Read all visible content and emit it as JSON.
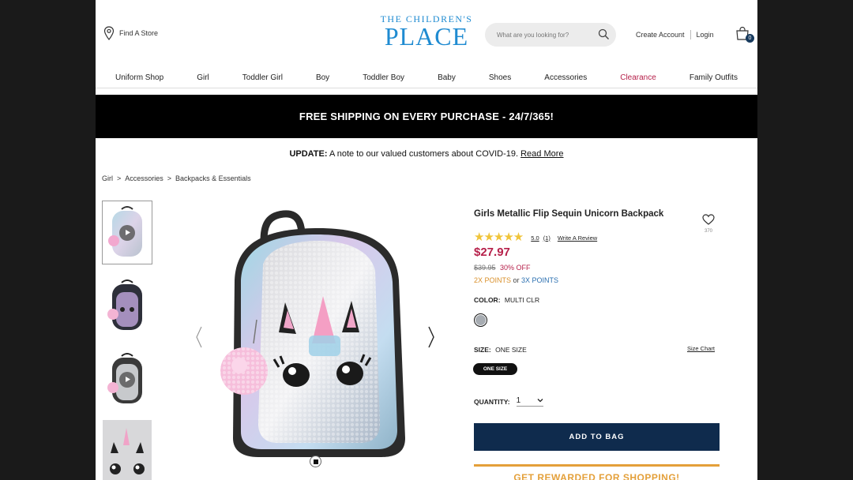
{
  "header": {
    "find_store": "Find A Store",
    "logo_line1": "THE CHILDREN'S",
    "logo_line2": "PLACE",
    "search_placeholder": "What are you looking for?",
    "create_account": "Create Account",
    "login": "Login",
    "bag_count": "0"
  },
  "nav": {
    "items": [
      "Uniform Shop",
      "Girl",
      "Toddler Girl",
      "Boy",
      "Toddler Boy",
      "Baby",
      "Shoes",
      "Accessories",
      "Clearance",
      "Family Outfits"
    ]
  },
  "promo": {
    "text": "FREE SHIPPING ON EVERY PURCHASE - 24/7/365!"
  },
  "update": {
    "bold": "UPDATE:",
    "text": " A note to our valued customers about COVID-19. ",
    "link": "Read More"
  },
  "breadcrumb": {
    "items": [
      "Girl",
      "Accessories",
      "Backpacks & Essentials"
    ],
    "separator": ">"
  },
  "product": {
    "title": "Girls Metallic Flip Sequin Unicorn Backpack",
    "favorites_count": "370",
    "stars": "★★★★★",
    "rating": "5.0",
    "review_count": "(1)",
    "write_review": "Write A Review",
    "price": "$27.97",
    "was_price": "$39.95",
    "discount": "30% OFF",
    "points_2x": "2X POINTS",
    "points_or": " or ",
    "points_3x": "3X POINTS",
    "color_label": "COLOR:",
    "color_value": "MULTI CLR",
    "size_label": "SIZE:",
    "size_value": "ONE SIZE",
    "size_chart": "Size Chart",
    "size_option": "ONE SIZE",
    "quantity_label": "QUANTITY:",
    "quantity_value": "1",
    "add_to_bag": "ADD TO BAG",
    "rewarded": "GET REWARDED FOR SHOPPING!"
  },
  "colors": {
    "accent_red": "#b6204a",
    "navy": "#0f2b4d",
    "gold": "#e4a03a",
    "logo_blue": "#1f8bd1"
  }
}
